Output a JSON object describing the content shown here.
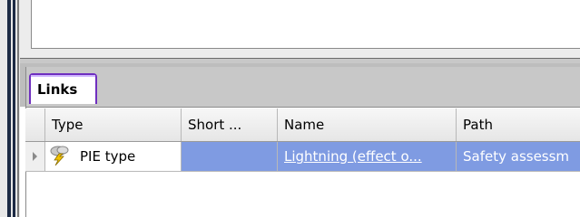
{
  "tabs": [
    {
      "label": "Links"
    }
  ],
  "columns": [
    "Type",
    "Short ...",
    "Name",
    "Path"
  ],
  "rows": [
    {
      "type": "PIE type",
      "type_icon": "lightning-icon",
      "short": "",
      "name": "Lightning (effect o...",
      "path": "Safety assessm"
    }
  ],
  "colors": {
    "selected_cell": "#7f9be2",
    "active_tab_border": "#6f2fbf"
  }
}
